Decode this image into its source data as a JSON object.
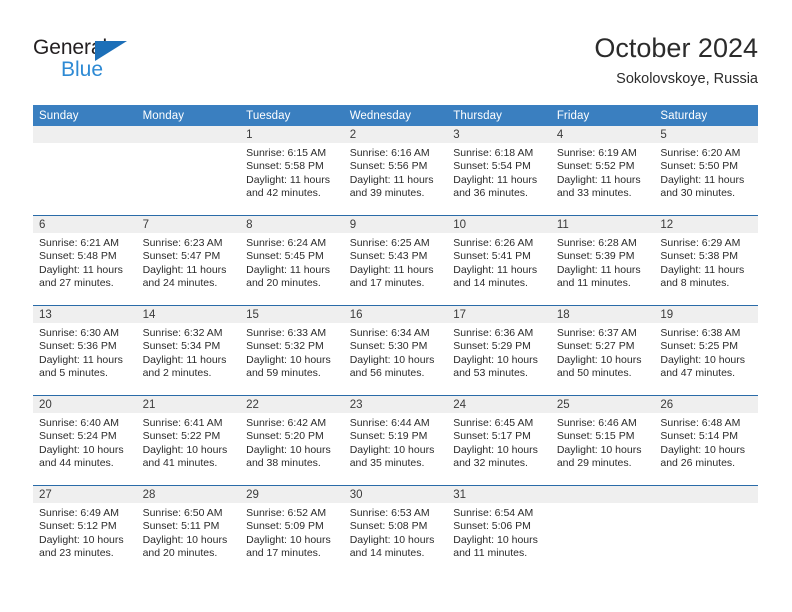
{
  "brand": {
    "name_top": "General",
    "name_bottom": "Blue",
    "triangle_color": "#1c6fb8",
    "top_color": "#231f20",
    "bottom_color": "#2e8ad4"
  },
  "header": {
    "month_title": "October 2024",
    "location": "Sokolovskoye, Russia"
  },
  "theme": {
    "header_blue": "#3a7fc0",
    "row_divider_blue": "#2a6ba8",
    "daynum_band": "#efefef",
    "text": "#2b2b2b"
  },
  "weekday_headers": [
    "Sunday",
    "Monday",
    "Tuesday",
    "Wednesday",
    "Thursday",
    "Friday",
    "Saturday"
  ],
  "weeks": [
    [
      {
        "day": "",
        "empty": true,
        "sunrise": "",
        "sunset": "",
        "daylight_line1": "",
        "daylight_line2": ""
      },
      {
        "day": "",
        "empty": true,
        "sunrise": "",
        "sunset": "",
        "daylight_line1": "",
        "daylight_line2": ""
      },
      {
        "day": "1",
        "empty": false,
        "sunrise": "Sunrise: 6:15 AM",
        "sunset": "Sunset: 5:58 PM",
        "daylight_line1": "Daylight: 11 hours",
        "daylight_line2": "and 42 minutes."
      },
      {
        "day": "2",
        "empty": false,
        "sunrise": "Sunrise: 6:16 AM",
        "sunset": "Sunset: 5:56 PM",
        "daylight_line1": "Daylight: 11 hours",
        "daylight_line2": "and 39 minutes."
      },
      {
        "day": "3",
        "empty": false,
        "sunrise": "Sunrise: 6:18 AM",
        "sunset": "Sunset: 5:54 PM",
        "daylight_line1": "Daylight: 11 hours",
        "daylight_line2": "and 36 minutes."
      },
      {
        "day": "4",
        "empty": false,
        "sunrise": "Sunrise: 6:19 AM",
        "sunset": "Sunset: 5:52 PM",
        "daylight_line1": "Daylight: 11 hours",
        "daylight_line2": "and 33 minutes."
      },
      {
        "day": "5",
        "empty": false,
        "sunrise": "Sunrise: 6:20 AM",
        "sunset": "Sunset: 5:50 PM",
        "daylight_line1": "Daylight: 11 hours",
        "daylight_line2": "and 30 minutes."
      }
    ],
    [
      {
        "day": "6",
        "empty": false,
        "sunrise": "Sunrise: 6:21 AM",
        "sunset": "Sunset: 5:48 PM",
        "daylight_line1": "Daylight: 11 hours",
        "daylight_line2": "and 27 minutes."
      },
      {
        "day": "7",
        "empty": false,
        "sunrise": "Sunrise: 6:23 AM",
        "sunset": "Sunset: 5:47 PM",
        "daylight_line1": "Daylight: 11 hours",
        "daylight_line2": "and 24 minutes."
      },
      {
        "day": "8",
        "empty": false,
        "sunrise": "Sunrise: 6:24 AM",
        "sunset": "Sunset: 5:45 PM",
        "daylight_line1": "Daylight: 11 hours",
        "daylight_line2": "and 20 minutes."
      },
      {
        "day": "9",
        "empty": false,
        "sunrise": "Sunrise: 6:25 AM",
        "sunset": "Sunset: 5:43 PM",
        "daylight_line1": "Daylight: 11 hours",
        "daylight_line2": "and 17 minutes."
      },
      {
        "day": "10",
        "empty": false,
        "sunrise": "Sunrise: 6:26 AM",
        "sunset": "Sunset: 5:41 PM",
        "daylight_line1": "Daylight: 11 hours",
        "daylight_line2": "and 14 minutes."
      },
      {
        "day": "11",
        "empty": false,
        "sunrise": "Sunrise: 6:28 AM",
        "sunset": "Sunset: 5:39 PM",
        "daylight_line1": "Daylight: 11 hours",
        "daylight_line2": "and 11 minutes."
      },
      {
        "day": "12",
        "empty": false,
        "sunrise": "Sunrise: 6:29 AM",
        "sunset": "Sunset: 5:38 PM",
        "daylight_line1": "Daylight: 11 hours",
        "daylight_line2": "and 8 minutes."
      }
    ],
    [
      {
        "day": "13",
        "empty": false,
        "sunrise": "Sunrise: 6:30 AM",
        "sunset": "Sunset: 5:36 PM",
        "daylight_line1": "Daylight: 11 hours",
        "daylight_line2": "and 5 minutes."
      },
      {
        "day": "14",
        "empty": false,
        "sunrise": "Sunrise: 6:32 AM",
        "sunset": "Sunset: 5:34 PM",
        "daylight_line1": "Daylight: 11 hours",
        "daylight_line2": "and 2 minutes."
      },
      {
        "day": "15",
        "empty": false,
        "sunrise": "Sunrise: 6:33 AM",
        "sunset": "Sunset: 5:32 PM",
        "daylight_line1": "Daylight: 10 hours",
        "daylight_line2": "and 59 minutes."
      },
      {
        "day": "16",
        "empty": false,
        "sunrise": "Sunrise: 6:34 AM",
        "sunset": "Sunset: 5:30 PM",
        "daylight_line1": "Daylight: 10 hours",
        "daylight_line2": "and 56 minutes."
      },
      {
        "day": "17",
        "empty": false,
        "sunrise": "Sunrise: 6:36 AM",
        "sunset": "Sunset: 5:29 PM",
        "daylight_line1": "Daylight: 10 hours",
        "daylight_line2": "and 53 minutes."
      },
      {
        "day": "18",
        "empty": false,
        "sunrise": "Sunrise: 6:37 AM",
        "sunset": "Sunset: 5:27 PM",
        "daylight_line1": "Daylight: 10 hours",
        "daylight_line2": "and 50 minutes."
      },
      {
        "day": "19",
        "empty": false,
        "sunrise": "Sunrise: 6:38 AM",
        "sunset": "Sunset: 5:25 PM",
        "daylight_line1": "Daylight: 10 hours",
        "daylight_line2": "and 47 minutes."
      }
    ],
    [
      {
        "day": "20",
        "empty": false,
        "sunrise": "Sunrise: 6:40 AM",
        "sunset": "Sunset: 5:24 PM",
        "daylight_line1": "Daylight: 10 hours",
        "daylight_line2": "and 44 minutes."
      },
      {
        "day": "21",
        "empty": false,
        "sunrise": "Sunrise: 6:41 AM",
        "sunset": "Sunset: 5:22 PM",
        "daylight_line1": "Daylight: 10 hours",
        "daylight_line2": "and 41 minutes."
      },
      {
        "day": "22",
        "empty": false,
        "sunrise": "Sunrise: 6:42 AM",
        "sunset": "Sunset: 5:20 PM",
        "daylight_line1": "Daylight: 10 hours",
        "daylight_line2": "and 38 minutes."
      },
      {
        "day": "23",
        "empty": false,
        "sunrise": "Sunrise: 6:44 AM",
        "sunset": "Sunset: 5:19 PM",
        "daylight_line1": "Daylight: 10 hours",
        "daylight_line2": "and 35 minutes."
      },
      {
        "day": "24",
        "empty": false,
        "sunrise": "Sunrise: 6:45 AM",
        "sunset": "Sunset: 5:17 PM",
        "daylight_line1": "Daylight: 10 hours",
        "daylight_line2": "and 32 minutes."
      },
      {
        "day": "25",
        "empty": false,
        "sunrise": "Sunrise: 6:46 AM",
        "sunset": "Sunset: 5:15 PM",
        "daylight_line1": "Daylight: 10 hours",
        "daylight_line2": "and 29 minutes."
      },
      {
        "day": "26",
        "empty": false,
        "sunrise": "Sunrise: 6:48 AM",
        "sunset": "Sunset: 5:14 PM",
        "daylight_line1": "Daylight: 10 hours",
        "daylight_line2": "and 26 minutes."
      }
    ],
    [
      {
        "day": "27",
        "empty": false,
        "sunrise": "Sunrise: 6:49 AM",
        "sunset": "Sunset: 5:12 PM",
        "daylight_line1": "Daylight: 10 hours",
        "daylight_line2": "and 23 minutes."
      },
      {
        "day": "28",
        "empty": false,
        "sunrise": "Sunrise: 6:50 AM",
        "sunset": "Sunset: 5:11 PM",
        "daylight_line1": "Daylight: 10 hours",
        "daylight_line2": "and 20 minutes."
      },
      {
        "day": "29",
        "empty": false,
        "sunrise": "Sunrise: 6:52 AM",
        "sunset": "Sunset: 5:09 PM",
        "daylight_line1": "Daylight: 10 hours",
        "daylight_line2": "and 17 minutes."
      },
      {
        "day": "30",
        "empty": false,
        "sunrise": "Sunrise: 6:53 AM",
        "sunset": "Sunset: 5:08 PM",
        "daylight_line1": "Daylight: 10 hours",
        "daylight_line2": "and 14 minutes."
      },
      {
        "day": "31",
        "empty": false,
        "sunrise": "Sunrise: 6:54 AM",
        "sunset": "Sunset: 5:06 PM",
        "daylight_line1": "Daylight: 10 hours",
        "daylight_line2": "and 11 minutes."
      },
      {
        "day": "",
        "empty": true,
        "sunrise": "",
        "sunset": "",
        "daylight_line1": "",
        "daylight_line2": ""
      },
      {
        "day": "",
        "empty": true,
        "sunrise": "",
        "sunset": "",
        "daylight_line1": "",
        "daylight_line2": ""
      }
    ]
  ]
}
